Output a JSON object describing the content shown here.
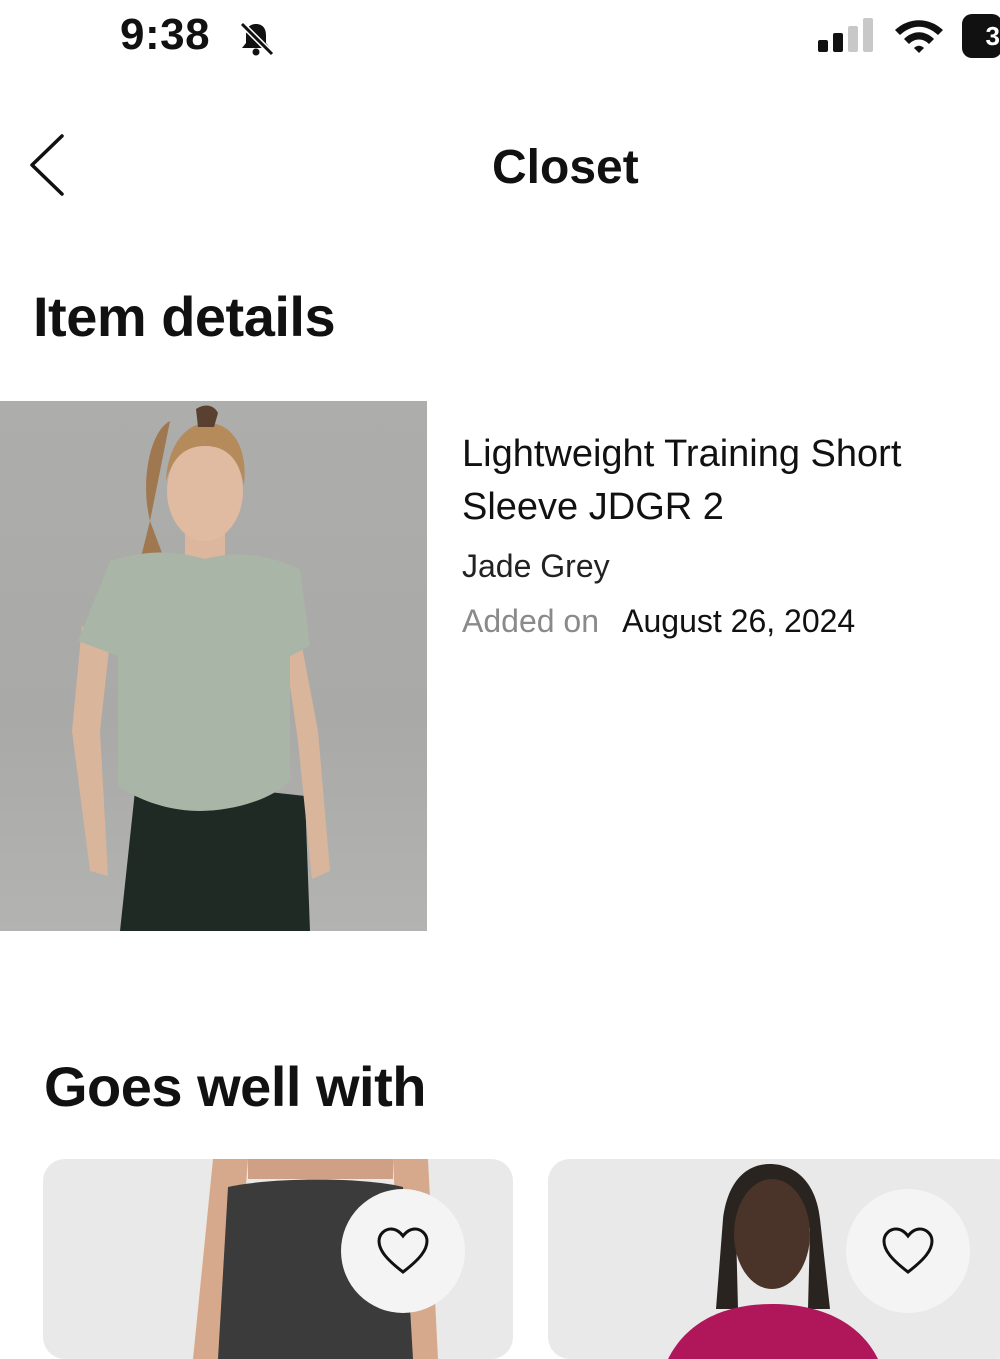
{
  "status_bar": {
    "time": "9:38",
    "battery": "3"
  },
  "nav": {
    "title": "Closet"
  },
  "item_details": {
    "heading": "Item details",
    "product_name": "Lightweight Training Short Sleeve JDGR 2",
    "color": "Jade Grey",
    "added_label": "Added on",
    "added_date": "August 26, 2024"
  },
  "goes_well_with": {
    "heading": "Goes well with"
  },
  "icons": {
    "back": "chevron-left-icon",
    "bell": "bell-slash-icon",
    "signal": "cellular-signal-icon",
    "wifi": "wifi-icon",
    "battery": "battery-icon",
    "heart": "heart-outline-icon"
  }
}
